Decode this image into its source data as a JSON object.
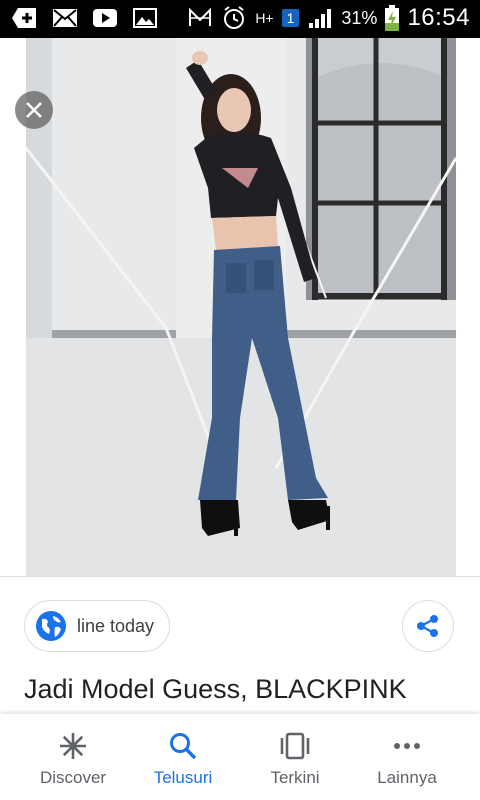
{
  "status_bar": {
    "battery": "31%",
    "time": "16:54",
    "network": "H+",
    "sim_slot": "1",
    "icons": [
      "add-icon",
      "mail-icon",
      "youtube-icon",
      "gallery-icon",
      "nfc-icon",
      "alarm-icon",
      "signal-icon",
      "battery-charging-icon"
    ]
  },
  "viewer": {
    "close_icon": "close-icon"
  },
  "source": {
    "label": "line today",
    "icon": "globe-icon",
    "accent": "#1a73e8"
  },
  "share": {
    "icon": "share-icon"
  },
  "result_title": "Jadi Model Guess, BLACKPINK",
  "bottom_nav": {
    "active_color": "#1a73e8",
    "items": [
      {
        "label": "Discover",
        "icon": "asterisk-icon"
      },
      {
        "label": "Telusuri",
        "icon": "search-icon"
      },
      {
        "label": "Terkini",
        "icon": "recent-cards-icon"
      },
      {
        "label": "Lainnya",
        "icon": "more-dots-icon"
      }
    ]
  }
}
